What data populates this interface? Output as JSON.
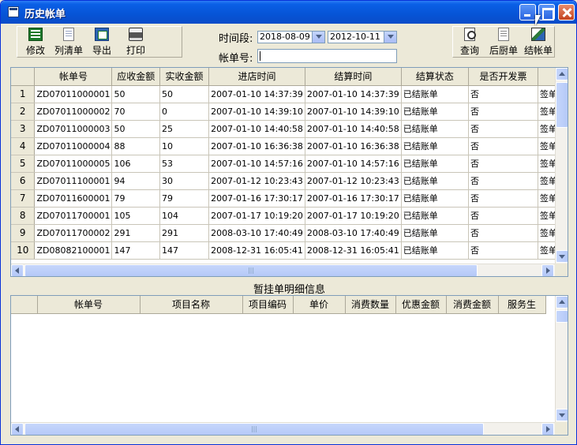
{
  "window": {
    "title": "历史帐单"
  },
  "toolbar_left": [
    {
      "label": "修改",
      "icon": "edit-icon"
    },
    {
      "label": "列清单",
      "icon": "list-icon"
    },
    {
      "label": "导出",
      "icon": "export-icon"
    },
    {
      "label": "打印",
      "icon": "print-icon"
    }
  ],
  "toolbar_right": [
    {
      "label": "查询",
      "icon": "query-icon"
    },
    {
      "label": "后厨单",
      "icon": "kitchen-order-icon"
    },
    {
      "label": "结帐单",
      "icon": "settlement-icon"
    }
  ],
  "filters": {
    "time_label": "时间段:",
    "start_date": "2018-08-09",
    "end_date": "2012-10-11",
    "bill_label": "帐单号:",
    "bill_value": ""
  },
  "history_table": {
    "columns": [
      "帐单号",
      "应收金额",
      "实收金额",
      "进店时间",
      "结算时间",
      "结算状态",
      "是否开发票",
      ""
    ],
    "rows": [
      [
        "1",
        "ZD07011000001",
        "50",
        "50",
        "2007-01-10 14:37:39",
        "2007-01-10 14:37:39",
        "已结账单",
        "否",
        "签单"
      ],
      [
        "2",
        "ZD07011000002",
        "70",
        "0",
        "2007-01-10 14:39:10",
        "2007-01-10 14:39:10",
        "已结账单",
        "否",
        "签单"
      ],
      [
        "3",
        "ZD07011000003",
        "50",
        "25",
        "2007-01-10 14:40:58",
        "2007-01-10 14:40:58",
        "已结账单",
        "否",
        "签单"
      ],
      [
        "4",
        "ZD07011000004",
        "88",
        "10",
        "2007-01-10 16:36:38",
        "2007-01-10 16:36:38",
        "已结账单",
        "否",
        "签单"
      ],
      [
        "5",
        "ZD07011000005",
        "106",
        "53",
        "2007-01-10 14:57:16",
        "2007-01-10 14:57:16",
        "已结账单",
        "否",
        "签单"
      ],
      [
        "6",
        "ZD07011100001",
        "94",
        "30",
        "2007-01-12 10:23:43",
        "2007-01-12 10:23:43",
        "已结账单",
        "否",
        "签单"
      ],
      [
        "7",
        "ZD07011600001",
        "79",
        "79",
        "2007-01-16 17:30:17",
        "2007-01-16 17:30:17",
        "已结账单",
        "否",
        "签单"
      ],
      [
        "8",
        "ZD07011700001",
        "105",
        "104",
        "2007-01-17 10:19:20",
        "2007-01-17 10:19:20",
        "已结账单",
        "否",
        "签单"
      ],
      [
        "9",
        "ZD07011700002",
        "291",
        "291",
        "2008-03-10 17:40:49",
        "2008-03-10 17:40:49",
        "已结账单",
        "否",
        "签单"
      ],
      [
        "10",
        "ZD08082100001",
        "147",
        "147",
        "2008-12-31 16:05:41",
        "2008-12-31 16:05:41",
        "已结账单",
        "否",
        "签单"
      ]
    ]
  },
  "detail_section": {
    "title": "暂挂单明细信息"
  },
  "detail_table": {
    "columns": [
      "帐单号",
      "项目名称",
      "项目编码",
      "单价",
      "消费数量",
      "优惠金额",
      "消费金额",
      "服务生"
    ]
  },
  "scroll_glyph": "|||"
}
